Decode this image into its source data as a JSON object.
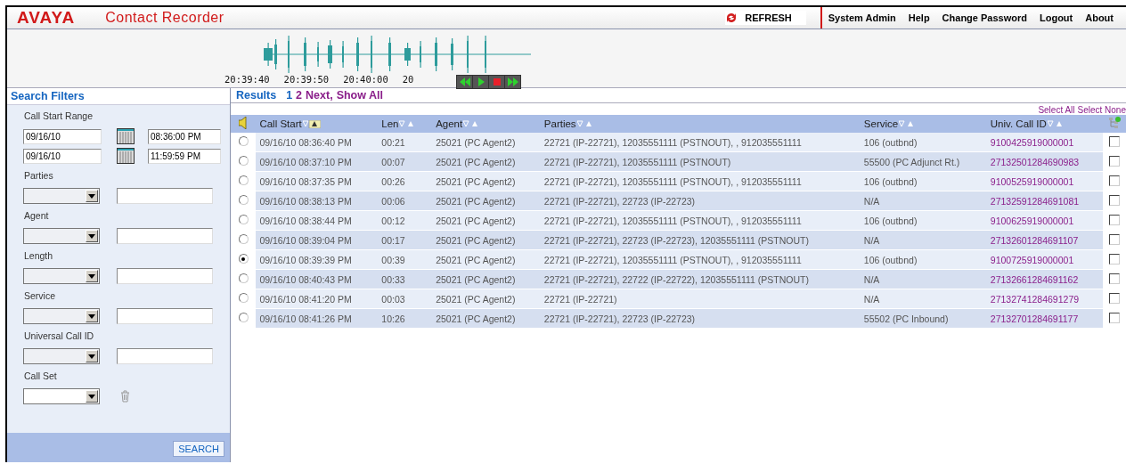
{
  "header": {
    "logo": "AVAYA",
    "app_title": "Contact Recorder",
    "refresh": "REFRESH",
    "menu": [
      "System Admin",
      "Help",
      "Change Password",
      "Logout",
      "About"
    ]
  },
  "player": {
    "times": [
      "20:39:40",
      "20:39:50",
      "20:40:00",
      "20"
    ],
    "controls": [
      {
        "kind": "rewind"
      },
      {
        "kind": "play"
      },
      {
        "kind": "stop"
      },
      {
        "kind": "forward"
      }
    ]
  },
  "filters": {
    "title": "Search Filters",
    "call_start_label": "Call Start Range",
    "ranges": [
      {
        "date": "09/16/10",
        "time": "08:36:00 PM"
      },
      {
        "date": "09/16/10",
        "time": "11:59:59 PM"
      }
    ],
    "fields": [
      {
        "label": "Parties"
      },
      {
        "label": "Agent"
      },
      {
        "label": "Length"
      },
      {
        "label": "Service"
      },
      {
        "label": "Universal Call ID"
      }
    ],
    "call_set_label": "Call Set",
    "search_button": "SEARCH"
  },
  "results": {
    "title": "Results",
    "pages": [
      {
        "label": "1",
        "selected": true
      },
      {
        "label": "2",
        "selected": false
      },
      {
        "label": "Next,",
        "selected": false
      },
      {
        "label": "Show All",
        "selected": false
      }
    ],
    "select_all": "Select All",
    "select_none": "Select None",
    "columns": [
      {
        "label": "Call Start",
        "sorted": true
      },
      {
        "label": "Len",
        "sorted": false
      },
      {
        "label": "Agent",
        "sorted": false
      },
      {
        "label": "Parties",
        "sorted": false
      },
      {
        "label": "Service",
        "sorted": false
      },
      {
        "label": "Univ. Call ID",
        "sorted": false
      }
    ],
    "rows": [
      {
        "selected": false,
        "checked": false,
        "cells": [
          "09/16/10 08:36:40 PM",
          "00:21",
          "25021 (PC Agent2)",
          "22721 (IP-22721), 12035551111 (PSTNOUT), , 912035551111",
          "106 (outbnd)",
          "9100425919000001"
        ]
      },
      {
        "selected": false,
        "checked": false,
        "cells": [
          "09/16/10 08:37:10 PM",
          "00:07",
          "25021 (PC Agent2)",
          "22721 (IP-22721), 12035551111 (PSTNOUT)",
          "55500 (PC Adjunct Rt.)",
          "27132501284690983"
        ]
      },
      {
        "selected": false,
        "checked": false,
        "cells": [
          "09/16/10 08:37:35 PM",
          "00:26",
          "25021 (PC Agent2)",
          "22721 (IP-22721), 12035551111 (PSTNOUT), , 912035551111",
          "106 (outbnd)",
          "9100525919000001"
        ]
      },
      {
        "selected": false,
        "checked": false,
        "cells": [
          "09/16/10 08:38:13 PM",
          "00:06",
          "25021 (PC Agent2)",
          "22721 (IP-22721), 22723 (IP-22723)",
          "N/A",
          "27132591284691081"
        ]
      },
      {
        "selected": false,
        "checked": false,
        "cells": [
          "09/16/10 08:38:44 PM",
          "00:12",
          "25021 (PC Agent2)",
          "22721 (IP-22721), 12035551111 (PSTNOUT), , 912035551111",
          "106 (outbnd)",
          "9100625919000001"
        ]
      },
      {
        "selected": false,
        "checked": false,
        "cells": [
          "09/16/10 08:39:04 PM",
          "00:17",
          "25021 (PC Agent2)",
          "22721 (IP-22721), 22723 (IP-22723), 12035551111 (PSTNOUT)",
          "N/A",
          "27132601284691107"
        ]
      },
      {
        "selected": true,
        "checked": false,
        "cells": [
          "09/16/10 08:39:39 PM",
          "00:39",
          "25021 (PC Agent2)",
          "22721 (IP-22721), 12035551111 (PSTNOUT), , 912035551111",
          "106 (outbnd)",
          "9100725919000001"
        ]
      },
      {
        "selected": false,
        "checked": false,
        "cells": [
          "09/16/10 08:40:43 PM",
          "00:33",
          "25021 (PC Agent2)",
          "22721 (IP-22721), 22722 (IP-22722), 12035551111 (PSTNOUT)",
          "N/A",
          "27132661284691162"
        ]
      },
      {
        "selected": false,
        "checked": false,
        "cells": [
          "09/16/10 08:41:20 PM",
          "00:03",
          "25021 (PC Agent2)",
          "22721 (IP-22721)",
          "N/A",
          "27132741284691279"
        ]
      },
      {
        "selected": false,
        "checked": false,
        "cells": [
          "09/16/10 08:41:26 PM",
          "10:26",
          "25021 (PC Agent2)",
          "22721 (IP-22721), 22723 (IP-22723)",
          "55502 (PC Inbound)",
          "27132701284691177"
        ]
      }
    ]
  }
}
